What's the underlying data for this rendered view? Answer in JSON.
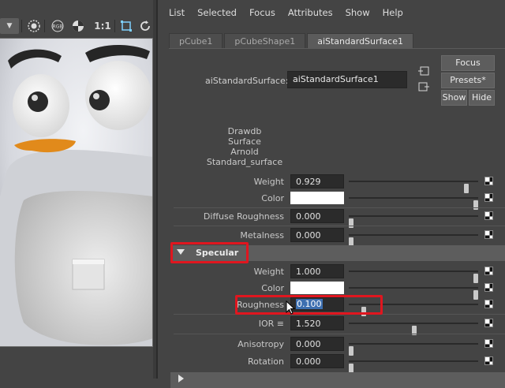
{
  "menu": [
    "List",
    "Selected",
    "Focus",
    "Attributes",
    "Show",
    "Help"
  ],
  "tabs": [
    {
      "label": "pCube1",
      "active": false
    },
    {
      "label": "pCubeShape1",
      "active": false
    },
    {
      "label": "aiStandardSurface1",
      "active": true
    }
  ],
  "node": {
    "label": "aiStandardSurface:",
    "value": "aiStandardSurface1"
  },
  "buttons": {
    "focus": "Focus",
    "presets": "Presets*",
    "show": "Show",
    "hide": "Hide"
  },
  "classification": [
    "Drawdb",
    "Surface",
    "Arnold",
    "Standard_surface"
  ],
  "viewport_toolbar": {
    "rgb": "RGB",
    "ratio": "1:1"
  },
  "base_attrs": [
    {
      "label": "Weight",
      "value": "0.929",
      "slider": 0.929
    },
    {
      "label": "Color",
      "color": "#ffffff",
      "slider": 1.0
    },
    {
      "label": "Diffuse Roughness",
      "value": "0.000",
      "slider": 0.0
    },
    {
      "label": "Metalness",
      "value": "0.000",
      "slider": 0.0
    }
  ],
  "specular": {
    "title": "Specular",
    "attrs": [
      {
        "label": "Weight",
        "value": "1.000",
        "slider": 1.0
      },
      {
        "label": "Color",
        "color": "#ffffff",
        "slider": 1.0
      },
      {
        "label": "Roughness",
        "value": "0.100",
        "slider": 0.1
      },
      {
        "label": "IOR ≡",
        "value": "1.520",
        "slider": 0.5
      },
      {
        "label": "Anisotropy",
        "value": "0.000",
        "slider": 0.0
      },
      {
        "label": "Rotation",
        "value": "0.000",
        "slider": 0.0
      }
    ]
  },
  "colors": {
    "highlight": "#e0161f",
    "selection": "#3d6fb0",
    "panel": "#444444",
    "field": "#2b2b2b"
  }
}
